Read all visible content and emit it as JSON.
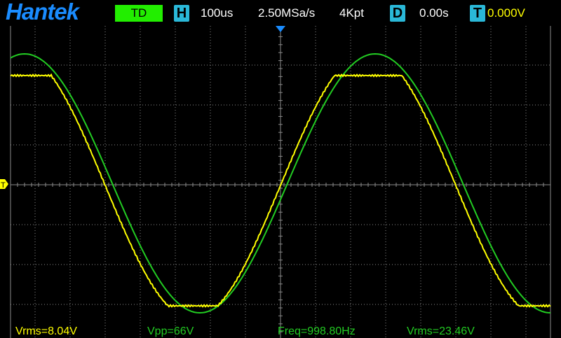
{
  "header": {
    "brand": "Hantek",
    "mode": "TD",
    "horizontal_tag": "H",
    "timebase": "100us",
    "sample_rate": "2.50MSa/s",
    "memory_depth": "4Kpt",
    "delay_tag": "D",
    "delay": "0.00s",
    "trigger_tag": "T",
    "trigger_level": "0.000V"
  },
  "markers": {
    "trigger_marker": "T"
  },
  "measurements": [
    {
      "label": "Vrms=8.04V",
      "color": "#ffff00"
    },
    {
      "label": "Vpp=66V",
      "color": "#22cc22"
    },
    {
      "label": "Freq=998.80Hz",
      "color": "#22cc22"
    },
    {
      "label": "Vrms=23.46V",
      "color": "#22cc22"
    }
  ],
  "colors": {
    "ch1": "#ffff00",
    "ch2": "#22cc22",
    "accent": "#2ab8d8",
    "brand": "#1a8cff"
  }
}
